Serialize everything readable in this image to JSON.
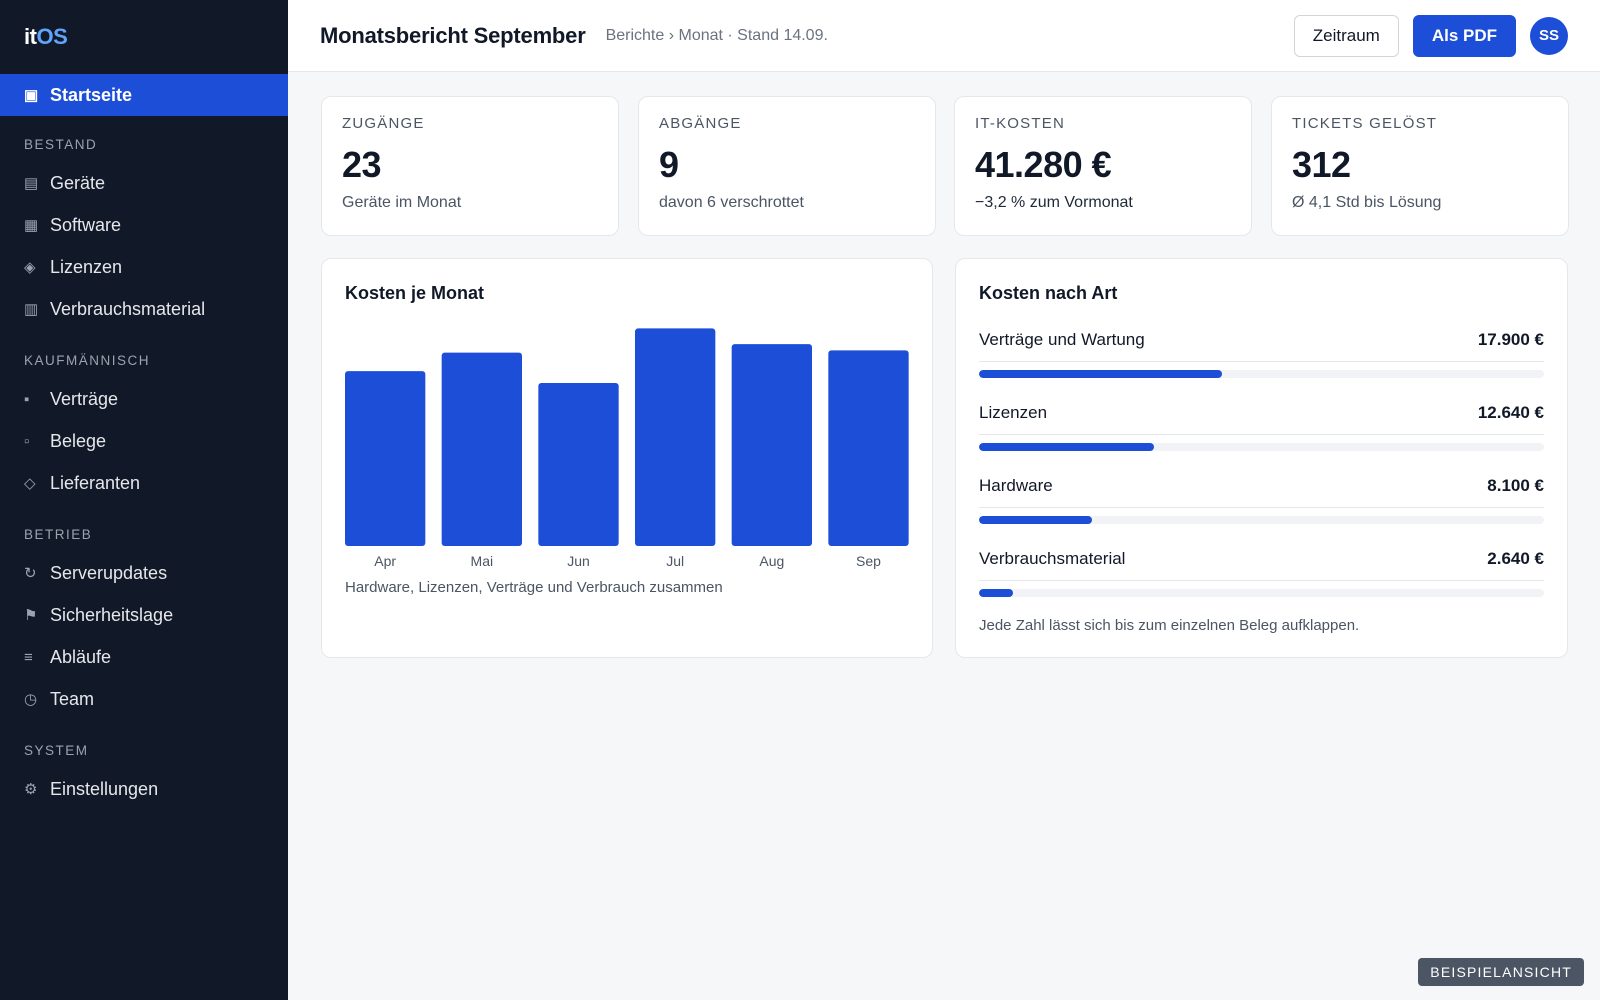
{
  "app": {
    "logo_a": "it",
    "logo_b": "OS"
  },
  "sidebar": {
    "active": {
      "label": "Startseite",
      "icon": "dashboard-icon"
    },
    "sections": [
      {
        "title": "BESTAND",
        "items": [
          {
            "label": "Geräte",
            "icon": "devices-icon"
          },
          {
            "label": "Software",
            "icon": "software-icon"
          },
          {
            "label": "Lizenzen",
            "icon": "license-icon"
          },
          {
            "label": "Verbrauchsmaterial",
            "icon": "supplies-icon"
          }
        ]
      },
      {
        "title": "KAUFMÄNNISCH",
        "items": [
          {
            "label": "Verträge",
            "icon": "contract-icon"
          },
          {
            "label": "Belege",
            "icon": "receipt-icon"
          },
          {
            "label": "Lieferanten",
            "icon": "supplier-icon"
          }
        ]
      },
      {
        "title": "BETRIEB",
        "items": [
          {
            "label": "Serverupdates",
            "icon": "refresh-icon"
          },
          {
            "label": "Sicherheitslage",
            "icon": "flag-icon"
          },
          {
            "label": "Abläufe",
            "icon": "list-icon"
          },
          {
            "label": "Team",
            "icon": "clock-icon"
          }
        ]
      },
      {
        "title": "SYSTEM",
        "items": [
          {
            "label": "Einstellungen",
            "icon": "gear-icon"
          }
        ]
      }
    ]
  },
  "header": {
    "title": "Monatsbericht September",
    "breadcrumb": "Berichte › Monat · Stand 14.09.",
    "period_button": "Zeitraum",
    "pdf_button": "Als PDF",
    "avatar": "SS"
  },
  "kpis": [
    {
      "label": "ZUGÄNGE",
      "value": "23",
      "sub": "Geräte im Monat"
    },
    {
      "label": "ABGÄNGE",
      "value": "9",
      "sub": "davon 6 verschrottet"
    },
    {
      "label": "IT-KOSTEN",
      "value": "41.280 €",
      "sub": "−3,2 % zum Vormonat"
    },
    {
      "label": "TICKETS GELÖST",
      "value": "312",
      "sub": "Ø 4,1 Std bis Lösung"
    }
  ],
  "chart_panel": {
    "title": "Kosten je Monat",
    "caption": "Hardware, Lizenzen, Verträge und Verbrauch zusammen"
  },
  "chart_data": {
    "type": "bar",
    "categories": [
      "Apr",
      "Mai",
      "Jun",
      "Jul",
      "Aug",
      "Sep"
    ],
    "values": [
      36.9,
      40.8,
      34.4,
      45.9,
      42.6,
      41.28
    ],
    "ylim": [
      0,
      50
    ],
    "color": "#1d4ed8",
    "grid": false,
    "title": "",
    "xlabel": "",
    "ylabel": ""
  },
  "costs_panel": {
    "title": "Kosten nach Art",
    "items": [
      {
        "label": "Verträge und Wartung",
        "value": "17.900 €",
        "share": 0.43
      },
      {
        "label": "Lizenzen",
        "value": "12.640 €",
        "share": 0.31
      },
      {
        "label": "Hardware",
        "value": "8.100 €",
        "share": 0.2
      },
      {
        "label": "Verbrauchsmaterial",
        "value": "2.640 €",
        "share": 0.06
      }
    ],
    "note": "Jede Zahl lässt sich bis zum einzelnen Beleg aufklappen."
  },
  "watermark": "BEISPIELANSICHT",
  "colors": {
    "accent": "#1d4ed8",
    "sidebar": "#111827"
  }
}
